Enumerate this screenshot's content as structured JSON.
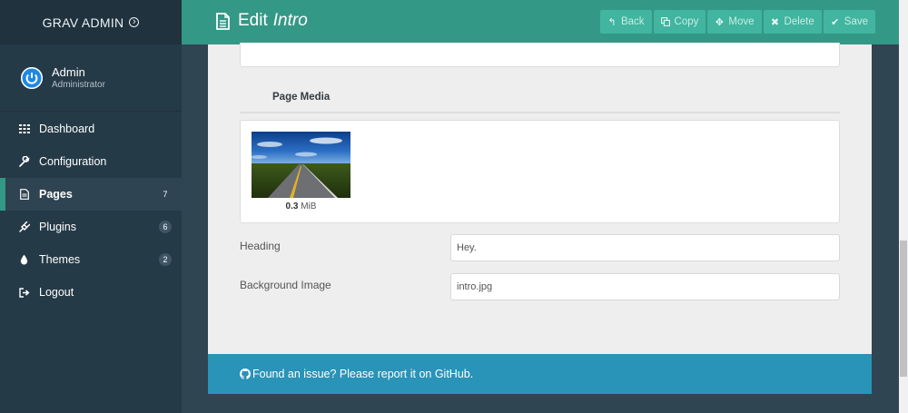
{
  "brand": {
    "label": "GRAV ADMIN"
  },
  "user": {
    "name": "Admin",
    "role": "Administrator"
  },
  "nav": [
    {
      "label": "Dashboard",
      "icon": "grid-icon"
    },
    {
      "label": "Configuration",
      "icon": "wrench-icon"
    },
    {
      "label": "Pages",
      "icon": "file-icon",
      "badge": "7",
      "active": true
    },
    {
      "label": "Plugins",
      "icon": "plug-icon",
      "badge": "6"
    },
    {
      "label": "Themes",
      "icon": "tint-icon",
      "badge": "2"
    },
    {
      "label": "Logout",
      "icon": "sign-out-icon"
    }
  ],
  "header": {
    "title_prefix": "Edit",
    "title_page": "Intro"
  },
  "toolbar": {
    "back_label": "Back",
    "copy_label": "Copy",
    "move_label": "Move",
    "delete_label": "Delete",
    "save_label": "Save"
  },
  "media": {
    "title": "Page Media",
    "file_size_value": "0.3",
    "file_size_unit": "MiB"
  },
  "fields": {
    "heading_label": "Heading",
    "heading_value": "Hey.",
    "background_label": "Background Image",
    "background_value": "intro.jpg"
  },
  "footer": {
    "text": "Found an issue? Please report it on GitHub."
  },
  "colors": {
    "sidebar": "#253a47",
    "header": "#349886",
    "button": "#41b59f",
    "footer": "#2a93b8",
    "content": "#eeeeee"
  }
}
